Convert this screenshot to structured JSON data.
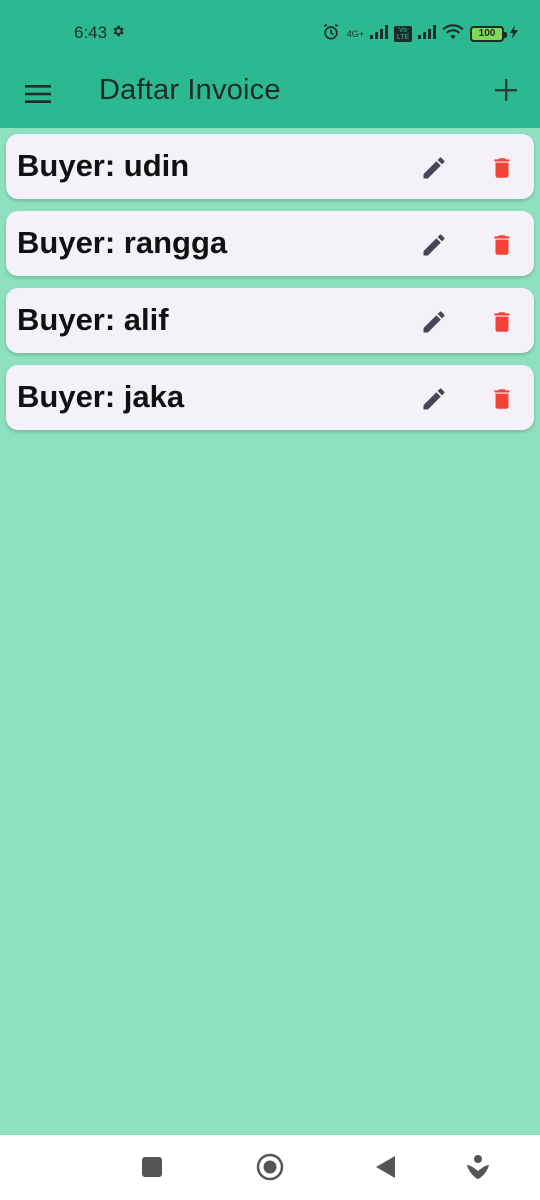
{
  "status_bar": {
    "time": "6:43",
    "network_label": "4G+",
    "volte_label": "Vo LTE",
    "battery_level": "100"
  },
  "app_bar": {
    "title": "Daftar Invoice",
    "menu_icon": "hamburger-menu-icon",
    "add_icon": "plus-icon"
  },
  "invoices": [
    {
      "label": "Buyer: udin"
    },
    {
      "label": "Buyer: rangga"
    },
    {
      "label": "Buyer: alif"
    },
    {
      "label": "Buyer: jaka"
    }
  ],
  "colors": {
    "app_bar": "#2CB992",
    "background": "#8DE0C0",
    "card": "#F5F1F8",
    "delete_icon": "#F44336",
    "edit_icon": "#4A4458"
  },
  "nav_bar": {
    "icons": [
      "recents-square-icon",
      "home-circle-icon",
      "back-triangle-icon",
      "assistant-icon"
    ]
  }
}
